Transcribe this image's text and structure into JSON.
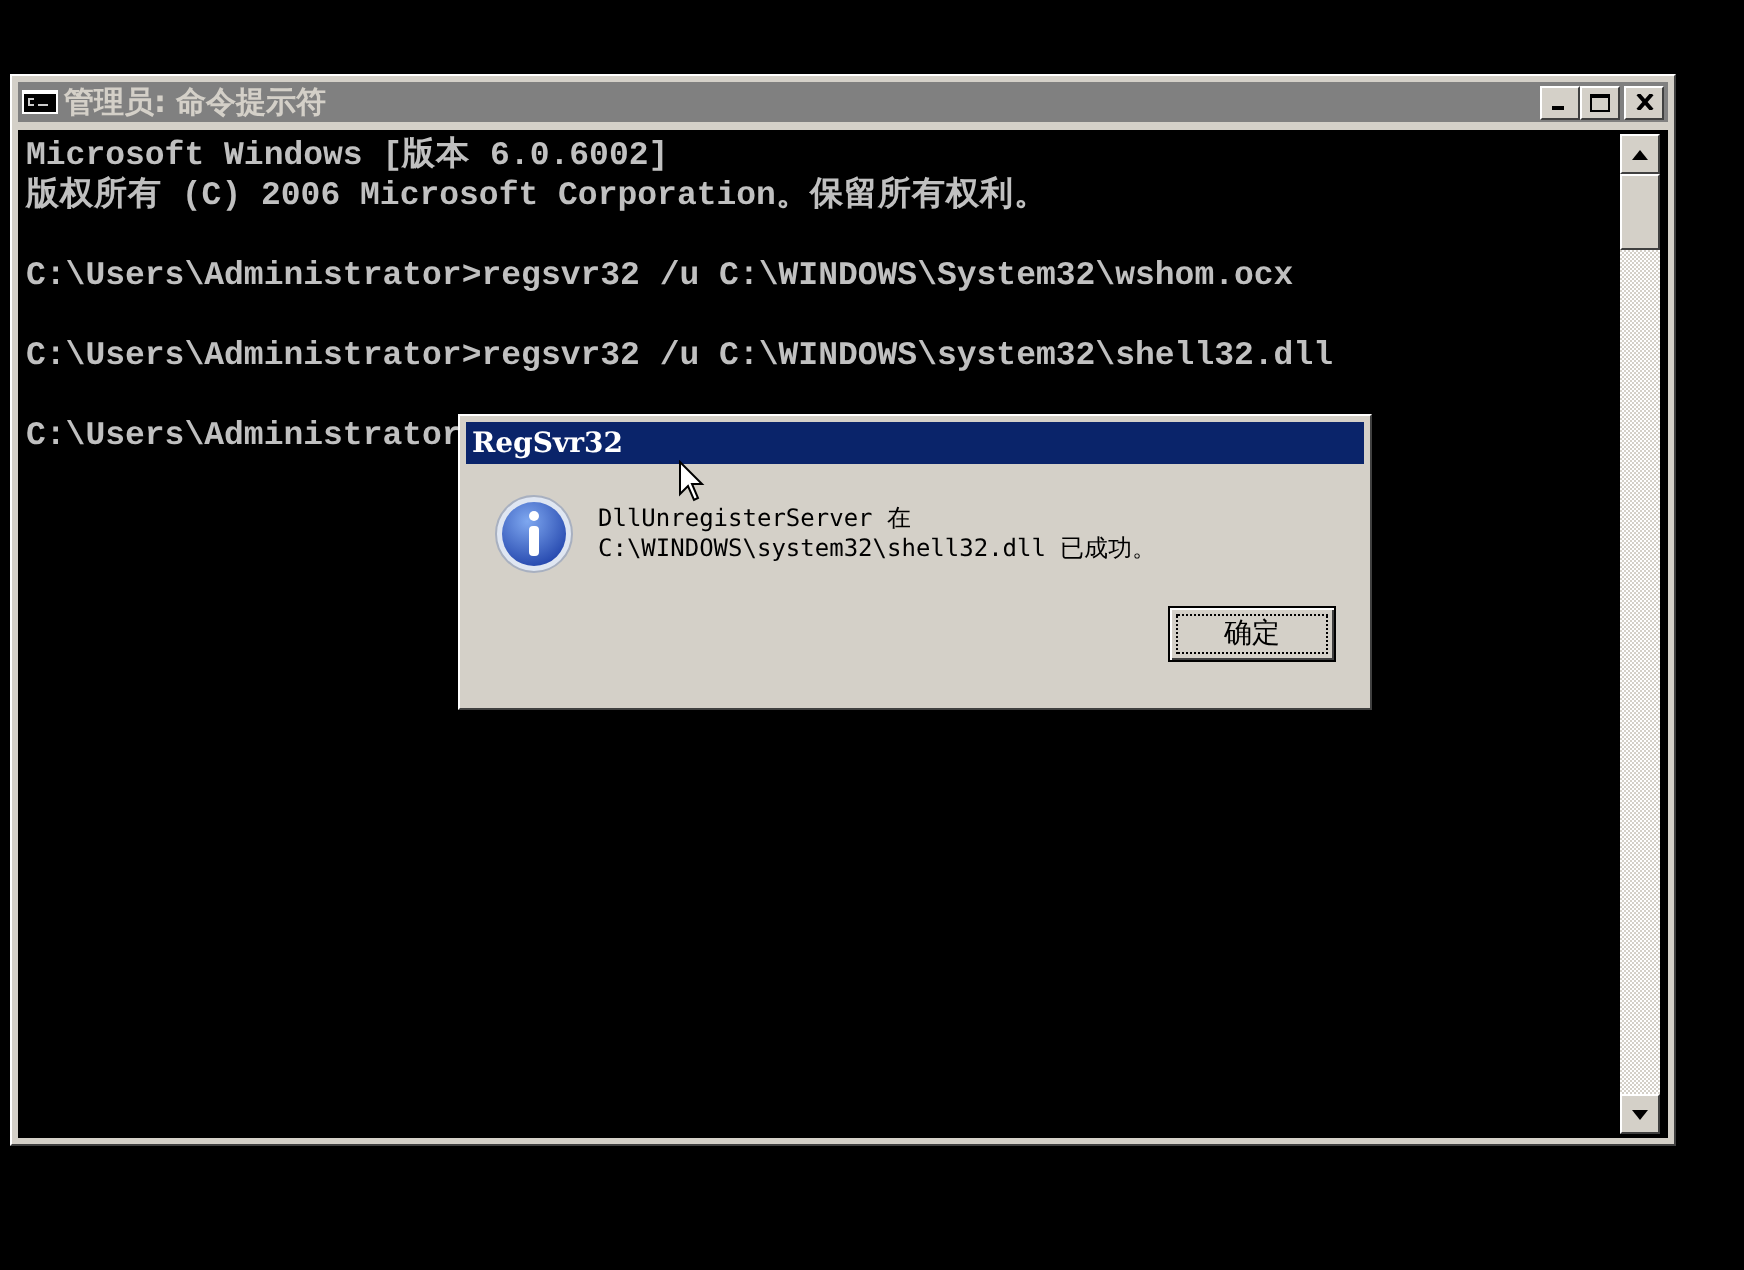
{
  "window": {
    "title": "管理员: 命令提示符",
    "active": false
  },
  "console": {
    "lines": [
      {
        "kind": "text",
        "text": "Microsoft Windows [版本 6.0.6002]"
      },
      {
        "kind": "text",
        "text": "版权所有 (C) 2006 Microsoft Corporation。保留所有权利。"
      },
      {
        "kind": "blank"
      },
      {
        "kind": "text",
        "text": "C:\\Users\\Administrator>regsvr32 /u C:\\WINDOWS\\System32\\wshom.ocx"
      },
      {
        "kind": "blank"
      },
      {
        "kind": "text",
        "text": "C:\\Users\\Administrator>regsvr32 /u C:\\WINDOWS\\system32\\shell32.dll"
      },
      {
        "kind": "blank"
      },
      {
        "kind": "text",
        "text": "C:\\Users\\Administrator"
      }
    ]
  },
  "dialog": {
    "title": "RegSvr32",
    "message_lines": [
      "DllUnregisterServer 在",
      "C:\\WINDOWS\\system32\\shell32.dll 已成功。"
    ],
    "button": "确定"
  }
}
